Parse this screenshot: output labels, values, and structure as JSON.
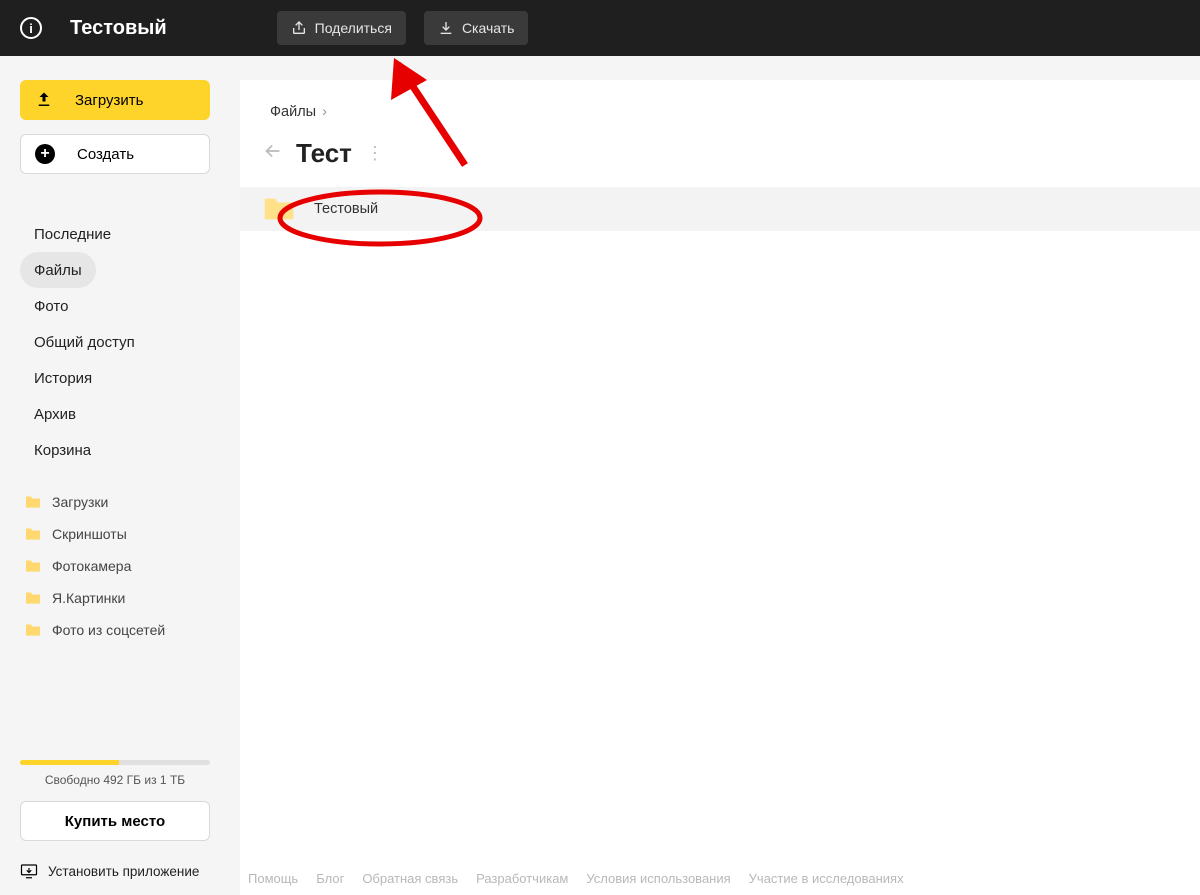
{
  "topbar": {
    "title": "Тестовый",
    "share": "Поделиться",
    "download": "Скачать"
  },
  "sidebar": {
    "upload": "Загрузить",
    "create": "Создать",
    "nav": [
      {
        "label": "Последние",
        "active": false
      },
      {
        "label": "Файлы",
        "active": true
      },
      {
        "label": "Фото",
        "active": false
      },
      {
        "label": "Общий доступ",
        "active": false
      },
      {
        "label": "История",
        "active": false
      },
      {
        "label": "Архив",
        "active": false
      },
      {
        "label": "Корзина",
        "active": false
      }
    ],
    "folders": [
      {
        "label": "Загрузки"
      },
      {
        "label": "Скриншоты"
      },
      {
        "label": "Фотокамера"
      },
      {
        "label": "Я.Картинки"
      },
      {
        "label": "Фото из соцсетей"
      }
    ],
    "storage_text": "Свободно 492 ГБ из 1 ТБ",
    "buy": "Купить место",
    "install": "Установить приложение"
  },
  "main": {
    "breadcrumb": "Файлы",
    "heading": "Тест",
    "rows": [
      {
        "name": "Тестовый"
      }
    ]
  },
  "footer": {
    "links": [
      "Помощь",
      "Блог",
      "Обратная связь",
      "Разработчикам",
      "Условия использования",
      "Участие в исследованиях"
    ]
  }
}
